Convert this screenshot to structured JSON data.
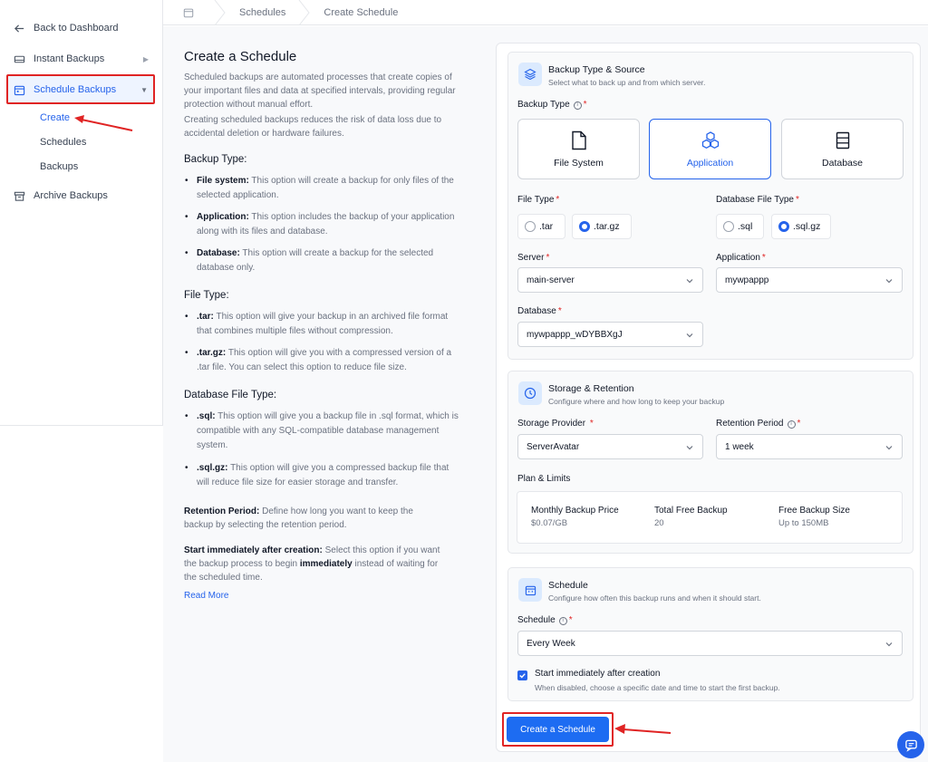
{
  "sidebar": {
    "back": "Back to Dashboard",
    "instant": "Instant Backups",
    "schedule": "Schedule Backups",
    "sub": [
      "Create",
      "Schedules",
      "Backups"
    ],
    "archive": "Archive Backups"
  },
  "breadcrumb": [
    "Schedules",
    "Create Schedule"
  ],
  "info": {
    "title": "Create a Schedule",
    "intro": "Scheduled backups are automated processes that create copies of your important files and data at specified intervals, providing regular protection without manual effort.",
    "intro2": "Creating scheduled backups reduces the risk of data loss due to accidental deletion or hardware failures.",
    "backup_type_heading": "Backup Type:",
    "backup_types": [
      {
        "term": "File system:",
        "desc": "This option will create a backup for only files of the selected application."
      },
      {
        "term": "Application:",
        "desc": "This option includes the backup of your application along with its files and database."
      },
      {
        "term": "Database:",
        "desc": "This option will create a backup for the selected database only."
      }
    ],
    "file_type_heading": "File Type:",
    "file_types": [
      {
        "term": ".tar:",
        "desc": "This option will give your backup in an archived file format that combines multiple files without compression."
      },
      {
        "term": ".tar.gz:",
        "desc": "This option will give you with a compressed version of a .tar file. You can select this option to reduce file size."
      }
    ],
    "db_file_type_heading": "Database File Type:",
    "db_file_types": [
      {
        "term": ".sql:",
        "desc": "This option will give you a backup file in .sql format, which is compatible with any SQL-compatible database management system."
      },
      {
        "term": ".sql.gz:",
        "desc": "This option will give you a compressed backup file that will reduce file size for easier storage and transfer."
      }
    ],
    "retention_term": "Retention Period:",
    "retention_desc": "Define how long you want to keep the backup by selecting the retention period.",
    "start_term": "Start immediately after creation:",
    "start_desc_1": "Select this option if you want the backup process to begin",
    "start_bold": "immediately",
    "start_desc_2": "instead of waiting for the scheduled time.",
    "read_more": "Read More"
  },
  "form": {
    "source": {
      "title": "Backup Type & Source",
      "subtitle": "Select what to back up and from which server.",
      "backup_type_label": "Backup Type",
      "tiles": [
        "File System",
        "Application",
        "Database"
      ],
      "selected_tile": "Application",
      "file_type_label": "File Type",
      "file_types": [
        ".tar",
        ".tar.gz"
      ],
      "file_type_selected": ".tar.gz",
      "db_file_type_label": "Database File Type",
      "db_file_types": [
        ".sql",
        ".sql.gz"
      ],
      "db_file_type_selected": ".sql.gz",
      "server_label": "Server",
      "server_value": "main-server",
      "application_label": "Application",
      "application_value": "mywpappp",
      "database_label": "Database",
      "database_value": "mywpappp_wDYBBXgJ"
    },
    "storage": {
      "title": "Storage & Retention",
      "subtitle": "Configure where and how long to keep your backup",
      "provider_label": "Storage Provider",
      "provider_value": "ServerAvatar",
      "retention_label": "Retention Period",
      "retention_value": "1 week",
      "plan_label": "Plan & Limits",
      "plan": [
        {
          "k": "Monthly Backup Price",
          "v": "$0.07/GB"
        },
        {
          "k": "Total Free Backup",
          "v": "20"
        },
        {
          "k": "Free Backup Size",
          "v": "Up to 150MB"
        }
      ]
    },
    "schedule": {
      "title": "Schedule",
      "subtitle": "Configure how often this backup runs and when it should start.",
      "label": "Schedule",
      "value": "Every Week",
      "start_title": "Start immediately after creation",
      "start_sub": "When disabled, choose a specific date and time to start the first backup.",
      "start_checked": true
    },
    "submit": "Create a Schedule"
  },
  "colors": {
    "accent": "#2563eb",
    "highlight": "#e02424"
  }
}
